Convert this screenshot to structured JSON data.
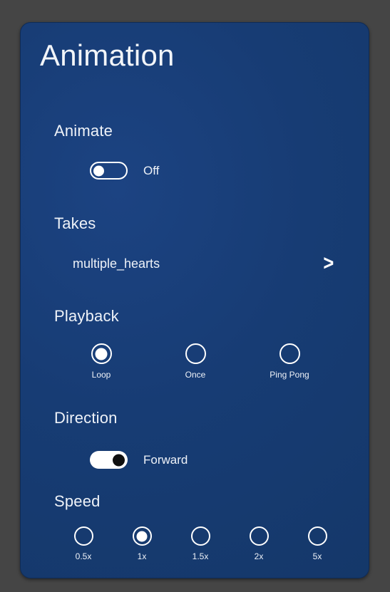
{
  "panel": {
    "title": "Animation",
    "accent_color": "#173c74",
    "page_background": "#454545"
  },
  "animate": {
    "section_label": "Animate",
    "toggle_state": "off",
    "toggle_label": "Off"
  },
  "takes": {
    "section_label": "Takes",
    "value": "multiple_hearts",
    "chevron": "›"
  },
  "playback": {
    "section_label": "Playback",
    "selected": "Loop",
    "options": [
      {
        "label": "Loop",
        "selected": true
      },
      {
        "label": "Once",
        "selected": false
      },
      {
        "label": "Ping Pong",
        "selected": false
      }
    ]
  },
  "direction": {
    "section_label": "Direction",
    "toggle_state": "on",
    "toggle_label": "Forward"
  },
  "speed": {
    "section_label": "Speed",
    "selected": "1x",
    "options": [
      {
        "label": "0.5x",
        "selected": false
      },
      {
        "label": "1x",
        "selected": true
      },
      {
        "label": "1.5x",
        "selected": false
      },
      {
        "label": "2x",
        "selected": false
      },
      {
        "label": "5x",
        "selected": false
      }
    ]
  }
}
